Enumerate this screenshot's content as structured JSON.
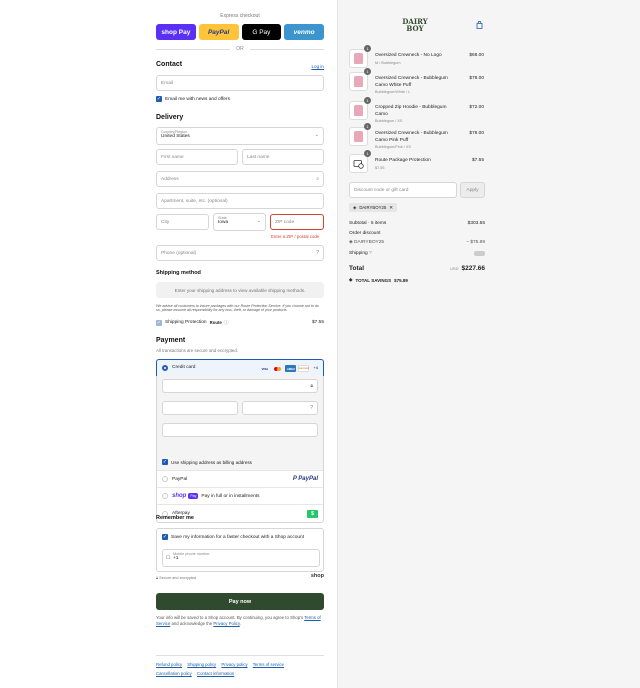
{
  "express": {
    "label": "Express checkout",
    "shop": "shop Pay",
    "paypal": "PayPal",
    "gpay": "G Pay",
    "venmo": "venmo",
    "or": "OR"
  },
  "contact": {
    "title": "Contact",
    "login": "Log in",
    "email_placeholder": "Email",
    "news_label": "Email me with news and offers"
  },
  "delivery": {
    "title": "Delivery",
    "country_label": "Country/Region",
    "country_value": "United States",
    "first_name": "First name",
    "last_name": "Last name",
    "address": "Address",
    "apartment": "Apartment, suite, etc. (optional)",
    "city": "City",
    "state_label": "State",
    "state_value": "Iowa",
    "zip": "ZIP code",
    "zip_error": "Enter a ZIP / postal code",
    "phone": "Phone (optional)"
  },
  "shipping": {
    "title": "Shipping method",
    "placeholder": "Enter your shipping address to view available shipping methods.",
    "disclaimer": "We advise all customers to insure packages with our Route Protection Service. If you choose not to do so, please assume all responsibility for any loss, theft, or damage of your products",
    "protection_label": "Shipping Protection",
    "route": "Route",
    "protection_price": "$7.55"
  },
  "payment": {
    "title": "Payment",
    "subtitle": "All transactions are secure and encrypted.",
    "credit_card": "Credit card",
    "more_cards": "+4",
    "billing_label": "Use shipping address as billing address",
    "paypal": "PayPal",
    "paypal_logo": "P PayPal",
    "shop_pay_text": "Pay in full or in installments",
    "shop_logo": "shop",
    "shop_pill": "Pay",
    "afterpay": "Afterpay",
    "afterpay_logo": "$",
    "card_visa": "VISA",
    "card_amex": "AMEX",
    "card_discover": "DISCOVER"
  },
  "remember": {
    "title": "Remember me",
    "save_label": "Save my information for a faster checkout with a Shop account",
    "mobile_label": "Mobile phone number",
    "mobile_value": "+1",
    "secure": "Secure and encrypted",
    "shop": "shop"
  },
  "pay_now": "Pay now",
  "legal": {
    "text1": "Your info will be saved to a Shop account. By continuing, you agree to Shop's",
    "terms": "Terms of Service",
    "text2": "and acknowledge the",
    "privacy": "Privacy Policy",
    "text3": "."
  },
  "footer": {
    "links": [
      "Refund policy",
      "Shipping policy",
      "Privacy policy",
      "Terms of service",
      "Cancellation policy",
      "Contact information"
    ]
  },
  "summary": {
    "brand_line1": "DAIRY",
    "brand_line2": "BOY",
    "items": [
      {
        "name": "Oversized Crewneck - No Logo",
        "variant": "M / Bubblegum",
        "price": "$68.00",
        "qty": "1"
      },
      {
        "name": "Oversized Crewneck - Bubblegum Camo White Puff",
        "variant": "Bubblegum/White / L",
        "price": "$78.00",
        "qty": "1"
      },
      {
        "name": "Cropped Zip Hoodie - Bubblegum Camo",
        "variant": "Bubblegum / XS",
        "price": "$72.00",
        "qty": "1"
      },
      {
        "name": "Oversized Crewneck - Bubblegum Camo Pink Puff",
        "variant": "Bubblegum/Pink / XS",
        "price": "$78.00",
        "qty": "1"
      },
      {
        "name": "Route Package Protection",
        "variant": "$7.55",
        "price": "$7.55",
        "qty": "1"
      }
    ],
    "discount_placeholder": "Discount code or gift card",
    "apply": "Apply",
    "tag": "DAIRYBOY25",
    "subtotal_label": "Subtotal · 5 items",
    "subtotal": "$303.55",
    "order_discount_label": "Order discount",
    "discount_code": "DAIRYBOY25",
    "discount_value": "– $75.89",
    "shipping_label": "Shipping",
    "total_label": "Total",
    "currency": "USD",
    "total": "$227.66",
    "savings_label": "TOTAL SAVINGS",
    "savings": "$75.89"
  },
  "colors": {
    "pay_button": "#2f4a2e",
    "accent": "#1f5bb3",
    "error": "#d8412f",
    "shop_purple": "#5a31f4"
  }
}
